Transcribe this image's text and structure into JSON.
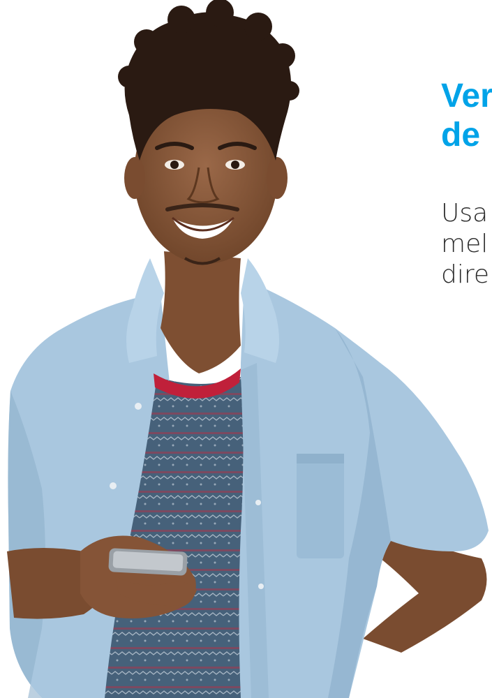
{
  "hero": {
    "headline": {
      "lines": [
        "Ver",
        "de"
      ],
      "color": "#00a3e8"
    },
    "subtext": {
      "lines": [
        "Usa",
        "mel",
        "dire"
      ],
      "color": "#2b2b2b"
    }
  },
  "colors": {
    "skin": "#8a5a3c",
    "skin_shadow": "#6e4429",
    "hair": "#2a1a12",
    "shirt": "#a9c7df",
    "shirt_shadow": "#8fb1cc",
    "tee": "#46617a",
    "tee_stripe_red": "#a8354a",
    "collar_red": "#c0203a",
    "phone": "#9aa0a6"
  }
}
